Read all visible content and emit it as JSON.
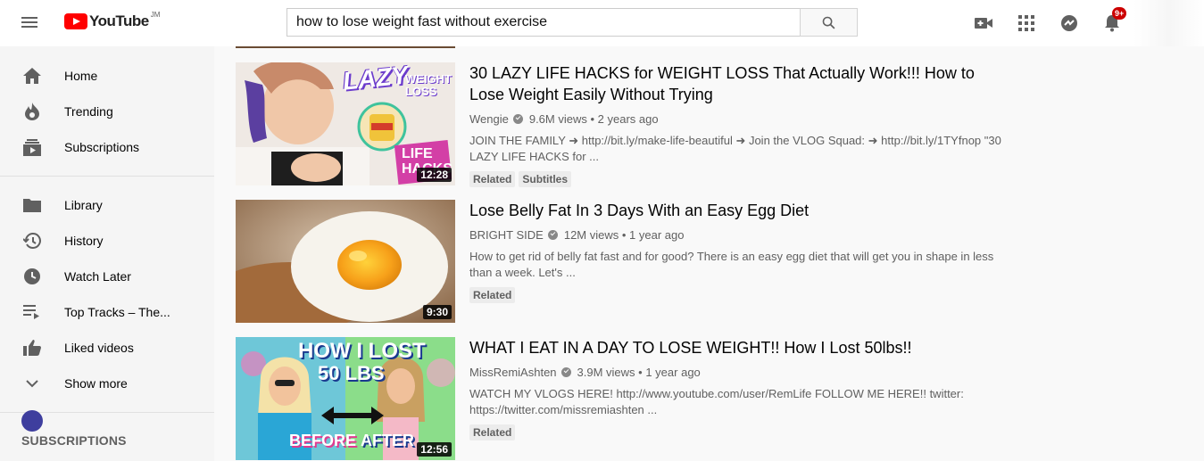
{
  "header": {
    "logo_text": "YouTube",
    "logo_region": "JM",
    "search_value": "how to lose weight fast without exercise",
    "notification_count": "9+"
  },
  "sidebar": {
    "items": [
      {
        "label": "Home",
        "icon": "home-icon"
      },
      {
        "label": "Trending",
        "icon": "trending-icon"
      },
      {
        "label": "Subscriptions",
        "icon": "subscriptions-icon"
      },
      {
        "label": "Library",
        "icon": "library-icon"
      },
      {
        "label": "History",
        "icon": "history-icon"
      },
      {
        "label": "Watch Later",
        "icon": "watch-later-icon"
      },
      {
        "label": "Top Tracks – The...",
        "icon": "playlist-icon"
      },
      {
        "label": "Liked videos",
        "icon": "thumbs-up-icon"
      },
      {
        "label": "Show more",
        "icon": "chevron-down-icon"
      }
    ],
    "subscriptions_heading": "SUBSCRIPTIONS"
  },
  "videos": [
    {
      "title": "30 LAZY LIFE HACKS for WEIGHT LOSS That Actually Work!!! How to Lose Weight Easily Without Trying",
      "channel": "Wengie",
      "views": "9.6M views",
      "age": "2 years ago",
      "description": "JOIN THE FAMILY ➜ http://bit.ly/make-life-beautiful ➜ Join the VLOG Squad: ➜ http://bit.ly/1TYfnop \"30 LAZY LIFE HACKS for ...",
      "duration": "12:28",
      "tags": [
        "Related",
        "Subtitles"
      ],
      "thumb_text_1": "LAZY",
      "thumb_text_2": "WEIGHT LOSS",
      "thumb_text_3": "LIFE HACKS"
    },
    {
      "title": "Lose Belly Fat In 3 Days With an Easy Egg Diet",
      "channel": "BRIGHT SIDE",
      "views": "12M views",
      "age": "1 year ago",
      "description": "How to get rid of belly fat fast and for good? There is an easy egg diet that will get you in shape in less than a week. Let's ...",
      "duration": "9:30",
      "tags": [
        "Related"
      ]
    },
    {
      "title": "WHAT I EAT IN A DAY TO LOSE WEIGHT!! How I Lost 50lbs!!",
      "channel": "MissRemiAshten",
      "views": "3.9M views",
      "age": "1 year ago",
      "description": "WATCH MY VLOGS HERE! http://www.youtube.com/user/RemLife FOLLOW ME HERE!! twitter: https://twitter.com/missremiashten ...",
      "duration": "12:56",
      "tags": [
        "Related"
      ],
      "thumb_text_1": "HOW I LOST",
      "thumb_text_2": "50 LBS",
      "thumb_text_3": "BEFORE",
      "thumb_text_4": "AFTER"
    }
  ]
}
